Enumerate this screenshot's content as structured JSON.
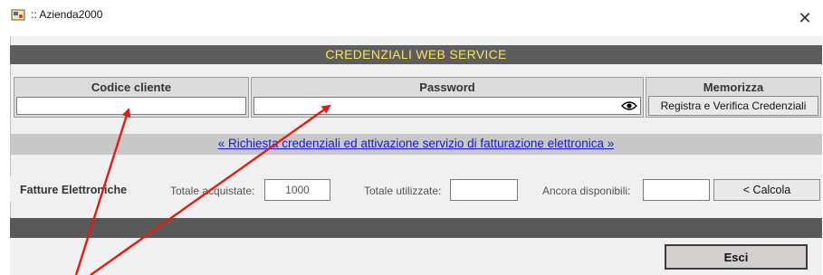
{
  "window": {
    "title": ":: Azienda2000",
    "close_symbol": "✕"
  },
  "banner": {
    "title": "CREDENZIALI WEB SERVICE"
  },
  "credentials": {
    "customer_code_header": "Codice cliente",
    "customer_code_value": "",
    "password_header": "Password",
    "password_value": "",
    "store_header": "Memorizza",
    "register_button": "Registra e Verifica Credenziali",
    "eye_icon": "eye-icon"
  },
  "link": {
    "text": "« Richiesta credenziali ed attivazione servizio di fatturazione elettronica »"
  },
  "invoices": {
    "section_label": "Fatture Elettroniche",
    "purchased_label": "Totale acquistate:",
    "purchased_value": "1000",
    "used_label": "Totale utilizzate:",
    "used_value": "",
    "remaining_label": "Ancora disponibili:",
    "remaining_value": "",
    "calculate_button": "< Calcola"
  },
  "footer": {
    "exit_button": "Esci"
  },
  "colors": {
    "banner_bg": "#5d5d5d",
    "banner_text": "#f7e35b",
    "link": "#1515e0",
    "annotation_arrow": "#e8190f"
  }
}
